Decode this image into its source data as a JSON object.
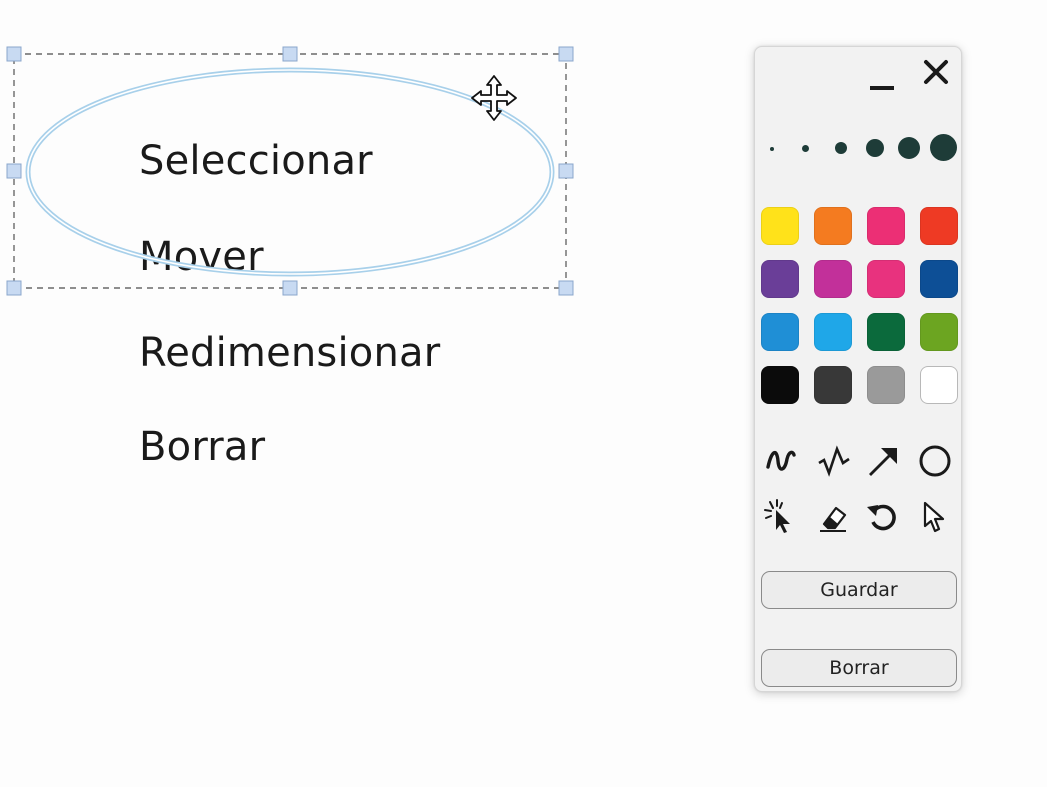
{
  "document": {
    "lines": [
      {
        "text": "Seleccionar"
      },
      {
        "text": "Mover"
      },
      {
        "text": "Redimensionar"
      },
      {
        "text": "Borrar"
      }
    ]
  },
  "toolbar": {
    "minimize_icon": "minimize-icon",
    "close_icon": "close-icon",
    "pen_sizes": [
      "size-1",
      "size-2",
      "size-3",
      "size-4",
      "size-5",
      "size-6"
    ],
    "colors": [
      [
        "#ffe21a",
        "#f47b20",
        "#ec2f75",
        "#ee3a24"
      ],
      [
        "#6a3e98",
        "#c2309a",
        "#e8327e",
        "#0d4f96"
      ],
      [
        "#1f8fd6",
        "#1fa7e8",
        "#0b6a3c",
        "#6ca521"
      ],
      [
        "#0b0b0b",
        "#383838",
        "#9a9a9a",
        "#ffffff"
      ]
    ],
    "tools": [
      "freehand-icon",
      "polyline-icon",
      "arrow-icon",
      "ellipse-icon",
      "laser-pointer-icon",
      "eraser-icon",
      "undo-icon",
      "select-pointer-icon"
    ],
    "save_label": "Guardar",
    "clear_label": "Borrar"
  },
  "colors": {
    "selection_outline": "#a8d0ea",
    "handle_fill": "#c8daf2",
    "handle_stroke": "#8aa6cc",
    "dots": "#1e3c38"
  }
}
